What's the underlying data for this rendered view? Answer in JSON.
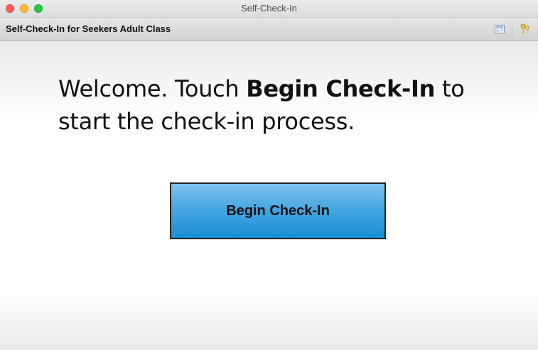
{
  "window": {
    "title": "Self-Check-In"
  },
  "header": {
    "title": "Self-Check-In for Seekers Adult Class",
    "icons": [
      "layout-icon",
      "keys-icon"
    ]
  },
  "main": {
    "welcome_prefix": "Welcome. Touch ",
    "welcome_bold": "Begin Check-In",
    "welcome_suffix": " to start the check-in process.",
    "begin_button_label": "Begin Check-In"
  },
  "colors": {
    "button_gradient_top": "#7fc3ee",
    "button_gradient_bottom": "#1a8dd6",
    "close": "#fe5f57",
    "minimize": "#febc2e",
    "maximize": "#28c840"
  }
}
